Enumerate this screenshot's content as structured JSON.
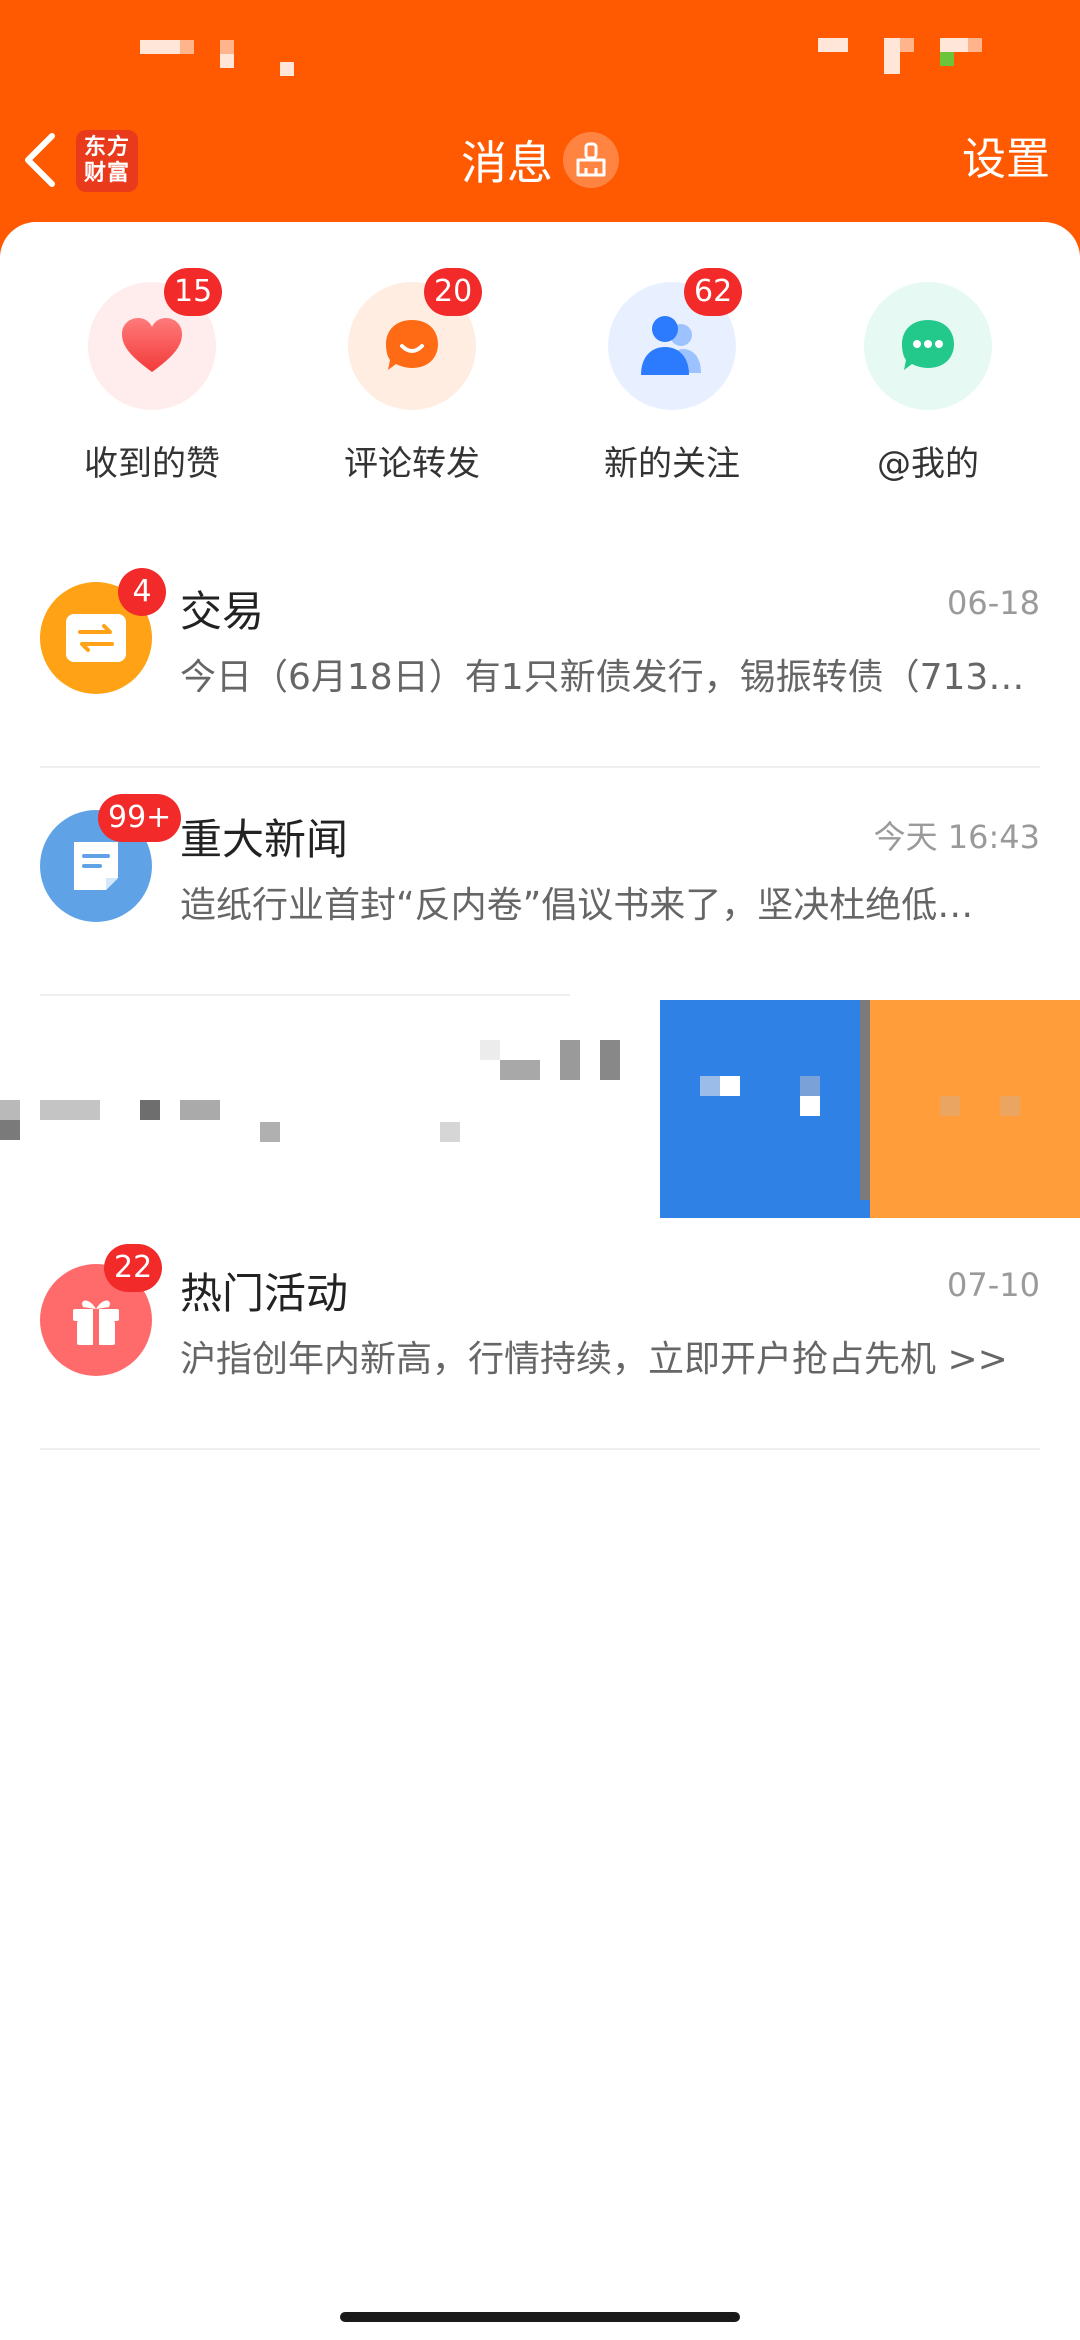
{
  "colors": {
    "brand": "#FF5A02",
    "badge": "#F22A2A"
  },
  "header": {
    "back_icon": "chevron-left-icon",
    "logo_line1": "东方",
    "logo_line2": "财富",
    "title": "消息",
    "clean_icon": "broom-icon",
    "settings_label": "设置"
  },
  "quick_actions": [
    {
      "label": "收到的赞",
      "badge": "15",
      "icon": "heart-icon"
    },
    {
      "label": "评论转发",
      "badge": "20",
      "icon": "comment-bubble-icon"
    },
    {
      "label": "新的关注",
      "badge": "62",
      "icon": "people-icon"
    },
    {
      "label": "@我的",
      "badge": "",
      "icon": "chat-dots-icon"
    }
  ],
  "messages": [
    {
      "title": "交易",
      "time": "06-18",
      "preview": "今日（6月18日）有1只新债发行，锡振转债（713…",
      "badge": "4",
      "icon": "exchange-icon"
    },
    {
      "title": "重大新闻",
      "time": "今天 16:43",
      "preview": "造纸行业首封“反内卷”倡议书来了，坚决杜绝低…",
      "badge": "99+",
      "icon": "document-icon"
    },
    {
      "title": "热门活动",
      "time": "07-10",
      "preview": "沪指创年内新高，行情持续，立即开户抢占先机 >>",
      "badge": "22",
      "icon": "gift-icon"
    }
  ]
}
